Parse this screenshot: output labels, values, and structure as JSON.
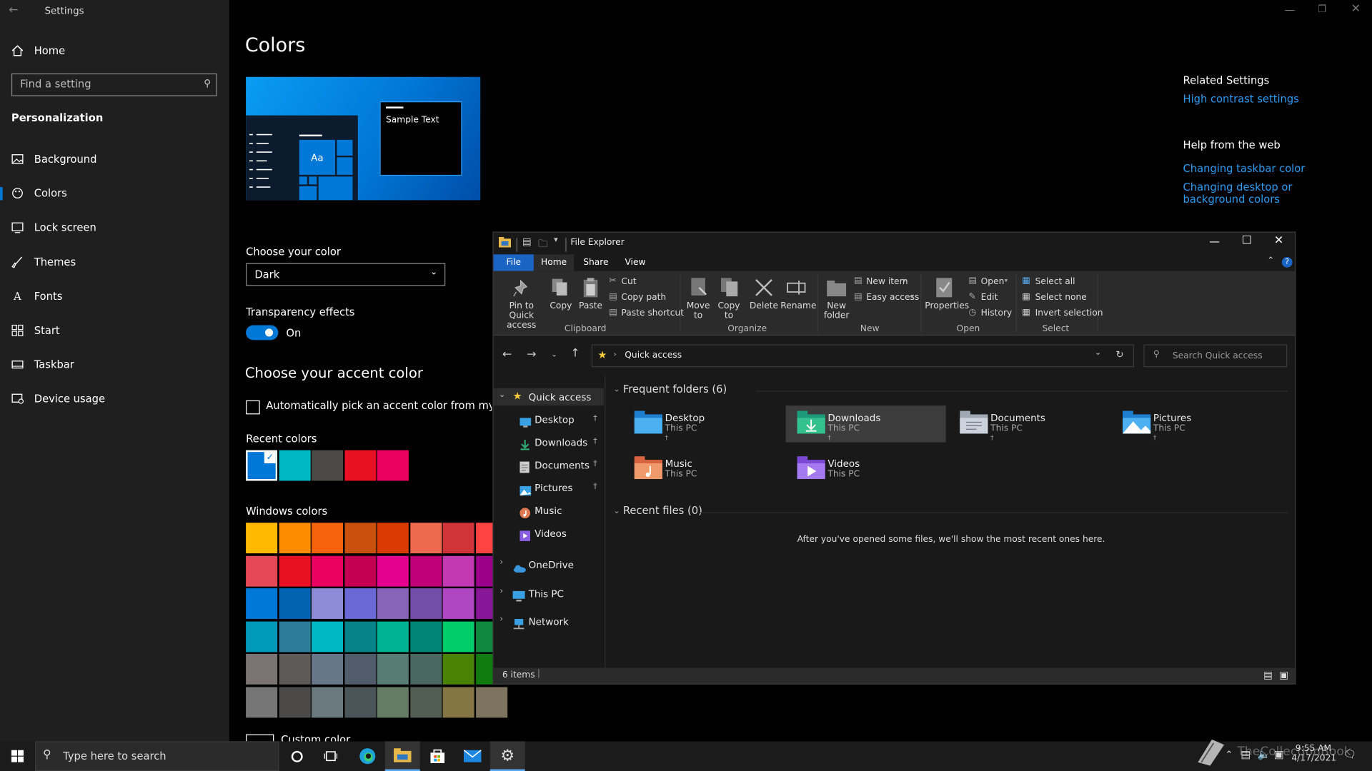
{
  "settings": {
    "title": "Settings",
    "home": "Home",
    "search_placeholder": "Find a setting",
    "section": "Personalization",
    "nav": [
      "Background",
      "Colors",
      "Lock screen",
      "Themes",
      "Fonts",
      "Start",
      "Taskbar",
      "Device usage"
    ],
    "selected_nav": "Colors",
    "page_title": "Colors",
    "preview_sample": "Sample Text",
    "preview_tile": "Aa",
    "choose_color_label": "Choose your color",
    "choose_color_value": "Dark",
    "transparency_label": "Transparency effects",
    "transparency_state": "On",
    "accent_title": "Choose your accent color",
    "auto_pick_label": "Automatically pick an accent color from my background",
    "recent_colors_label": "Recent colors",
    "recent_colors": [
      "#0078d7",
      "#00b7c3",
      "#4c4a48",
      "#e81123",
      "#ea005e"
    ],
    "windows_colors_label": "Windows colors",
    "windows_colors": [
      [
        "#ffb900",
        "#ff8c00",
        "#f7630c",
        "#ca5010",
        "#da3b01",
        "#ef6950",
        "#d13438",
        "#ff4343"
      ],
      [
        "#e74856",
        "#e81123",
        "#ea005e",
        "#c30052",
        "#e3008c",
        "#bf0077",
        "#c239b3",
        "#9a0089"
      ],
      [
        "#0078d7",
        "#0063b1",
        "#8e8cd8",
        "#6b69d6",
        "#8764b8",
        "#744da9",
        "#b146c2",
        "#881798"
      ],
      [
        "#0099bc",
        "#2d7d9a",
        "#00b7c3",
        "#038387",
        "#00b294",
        "#018574",
        "#00cc6a",
        "#10893e"
      ],
      [
        "#7a7574",
        "#5d5a58",
        "#68768a",
        "#515c6b",
        "#567c73",
        "#486860",
        "#498205",
        "#107c10"
      ],
      [
        "#767676",
        "#4c4a48",
        "#69797e",
        "#4a5459",
        "#647c64",
        "#525e54",
        "#847545",
        "#7e735f"
      ]
    ],
    "custom_color": "Custom color",
    "related_title": "Related Settings",
    "related_link": "High contrast settings",
    "help_title": "Help from the web",
    "help_links": [
      "Changing taskbar color",
      "Changing desktop or background colors"
    ]
  },
  "explorer": {
    "title": "File Explorer",
    "tabs": [
      "File",
      "Home",
      "Share",
      "View"
    ],
    "active_tab": "Home",
    "clipboard": {
      "pin": "Pin to Quick access",
      "copy": "Copy",
      "paste": "Paste",
      "cut": "Cut",
      "copy_path": "Copy path",
      "paste_shortcut": "Paste shortcut",
      "group": "Clipboard"
    },
    "organize": {
      "move_to": "Move to",
      "copy_to": "Copy to",
      "delete": "Delete",
      "rename": "Rename",
      "group": "Organize"
    },
    "new": {
      "new_folder": "New folder",
      "new_item": "New item",
      "easy_access": "Easy access",
      "group": "New"
    },
    "open": {
      "properties": "Properties",
      "open": "Open",
      "edit": "Edit",
      "history": "History",
      "group": "Open"
    },
    "select": {
      "select_all": "Select all",
      "select_none": "Select none",
      "invert": "Invert selection",
      "group": "Select"
    },
    "address": "Quick access",
    "search_placeholder": "Search Quick access",
    "nav_pane": {
      "quick_access": "Quick access",
      "pinned": [
        "Desktop",
        "Downloads",
        "Documents",
        "Pictures"
      ],
      "unpinned": [
        "Music",
        "Videos"
      ],
      "roots": [
        "OneDrive",
        "This PC",
        "Network"
      ]
    },
    "frequent_header": "Frequent folders (6)",
    "folders": [
      {
        "name": "Desktop",
        "location": "This PC",
        "pinned": true
      },
      {
        "name": "Downloads",
        "location": "This PC",
        "pinned": true
      },
      {
        "name": "Documents",
        "location": "This PC",
        "pinned": true
      },
      {
        "name": "Pictures",
        "location": "This PC",
        "pinned": true
      },
      {
        "name": "Music",
        "location": "This PC",
        "pinned": false
      },
      {
        "name": "Videos",
        "location": "This PC",
        "pinned": false
      }
    ],
    "recent_header": "Recent files (0)",
    "recent_empty": "After you've opened some files, we'll show the most recent ones here.",
    "status": "6 items"
  },
  "taskbar": {
    "search_placeholder": "Type here to search",
    "time": "9:55 AM",
    "date": "4/17/2021",
    "watermark": "TheCollectionBook"
  },
  "colors": {
    "accent": "#0078d7",
    "link": "#2d9bf0",
    "sidebar_bg": "#1f1f1f",
    "explorer_bg": "#191919"
  }
}
